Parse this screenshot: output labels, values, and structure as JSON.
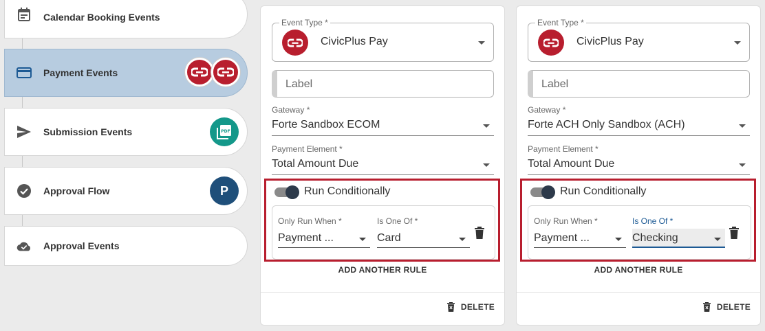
{
  "sidebar": {
    "items": [
      {
        "label": "Calendar Booking Events",
        "icon": "calendar-icon"
      },
      {
        "label": "Payment Events",
        "icon": "credit-card-icon",
        "active": true,
        "badges": [
          "civicplus-logo",
          "civicplus-logo"
        ]
      },
      {
        "label": "Submission Events",
        "icon": "send-icon",
        "badges": [
          "pdf-icon"
        ]
      },
      {
        "label": "Approval Flow",
        "icon": "check-circle-icon",
        "badges": [
          "P"
        ]
      },
      {
        "label": "Approval Events",
        "icon": "cloud-done-icon"
      }
    ]
  },
  "cards": [
    {
      "event_type_label": "Event Type *",
      "event_type_value": "CivicPlus Pay",
      "label_placeholder": "Label",
      "gateway_label": "Gateway *",
      "gateway_value": "Forte Sandbox ECOM",
      "payment_element_label": "Payment Element *",
      "payment_element_value": "Total Amount Due",
      "run_conditionally_label": "Run Conditionally",
      "run_conditionally_on": true,
      "rule": {
        "when_label": "Only Run When *",
        "when_value": "Payment ...",
        "is_one_of_label": "Is One Of *",
        "is_one_of_value": "Card"
      },
      "add_rule_label": "ADD ANOTHER RULE",
      "delete_label": "DELETE"
    },
    {
      "event_type_label": "Event Type *",
      "event_type_value": "CivicPlus Pay",
      "label_placeholder": "Label",
      "gateway_label": "Gateway *",
      "gateway_value": "Forte ACH Only Sandbox (ACH)",
      "payment_element_label": "Payment Element *",
      "payment_element_value": "Total Amount Due",
      "run_conditionally_label": "Run Conditionally",
      "run_conditionally_on": true,
      "rule": {
        "when_label": "Only Run When *",
        "when_value": "Payment ...",
        "is_one_of_label": "Is One Of *",
        "is_one_of_value": "Checking"
      },
      "add_rule_label": "ADD ANOTHER RULE",
      "delete_label": "DELETE"
    }
  ],
  "colors": {
    "accent_red": "#b81e2e",
    "active_nav": "#b7cce0",
    "focus_blue": "#1d5a94"
  }
}
